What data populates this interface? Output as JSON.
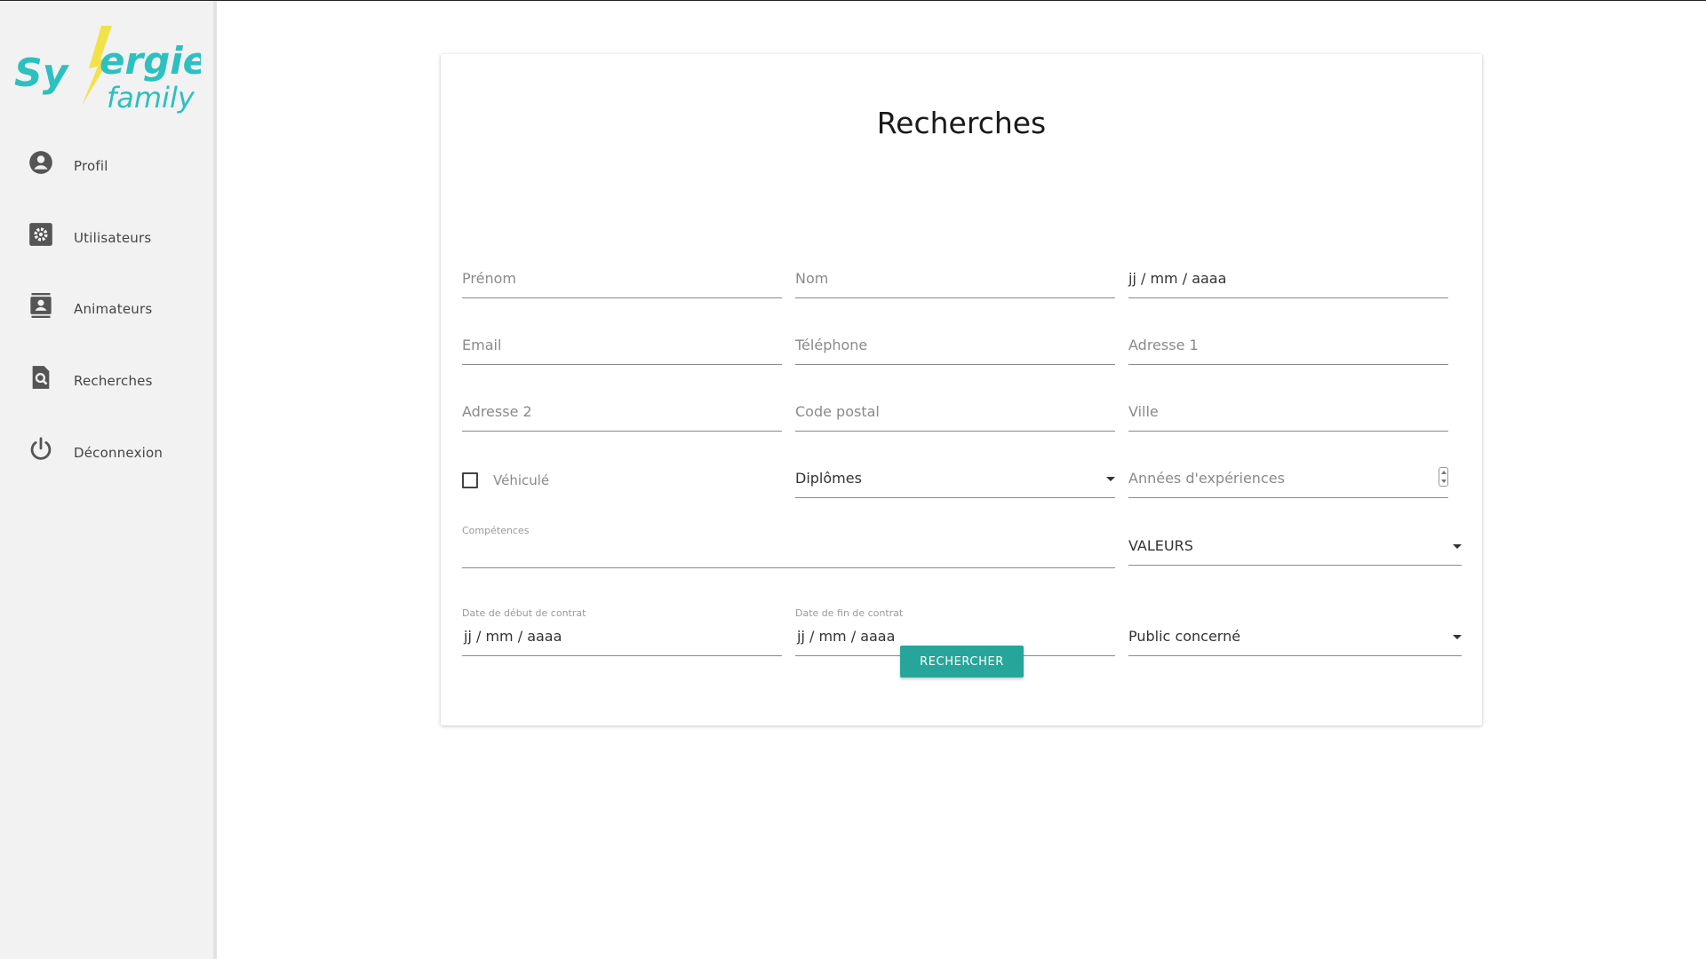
{
  "app": {
    "logo_text_1": "Synergie",
    "logo_text_2": "family",
    "accent_color": "#26a69a",
    "logo_color": "#2cc0c0",
    "bolt_color": "#f2e24a"
  },
  "sidebar": {
    "items": [
      {
        "label": "Profil",
        "icon": "account-circle-icon"
      },
      {
        "label": "Utilisateurs",
        "icon": "settings-box-icon"
      },
      {
        "label": "Animateurs",
        "icon": "contact-card-icon"
      },
      {
        "label": "Recherches",
        "icon": "search-document-icon"
      },
      {
        "label": "Déconnexion",
        "icon": "power-icon"
      }
    ]
  },
  "form": {
    "title": "Recherches",
    "prenom_placeholder": "Prénom",
    "nom_placeholder": "Nom",
    "date_naissance_value": "jj / mm / aaaa",
    "email_placeholder": "Email",
    "telephone_placeholder": "Téléphone",
    "adresse1_placeholder": "Adresse 1",
    "adresse2_placeholder": "Adresse 2",
    "code_postal_placeholder": "Code postal",
    "ville_placeholder": "Ville",
    "vehicule_label": "Véhiculé",
    "vehicule_checked": false,
    "diplomes_select": "Diplômes",
    "annees_placeholder": "Années d'expériences",
    "competences_label": "Compétences",
    "valeurs_select": "VALEURS",
    "date_debut_label": "Date de début de contrat",
    "date_debut_value": "jj / mm / aaaa",
    "date_fin_label": "Date de fin de contrat",
    "date_fin_value": "jj / mm / aaaa",
    "public_select": "Public concerné",
    "submit_label": "RECHERCHER"
  }
}
